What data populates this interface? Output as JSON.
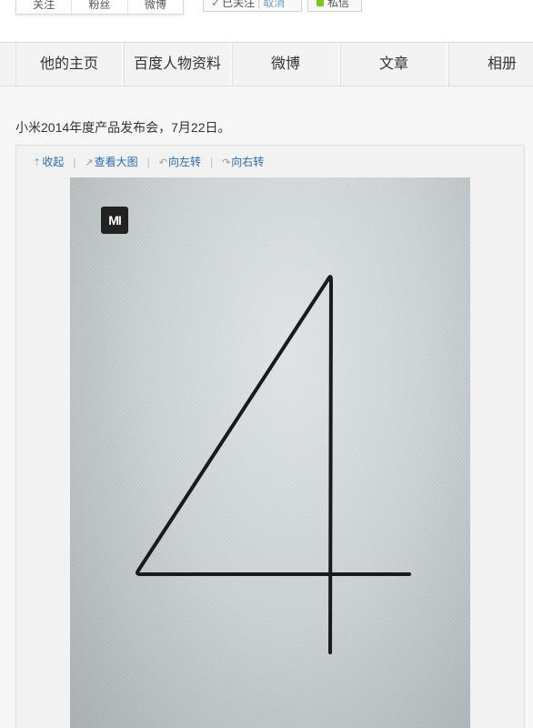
{
  "profile_bar": {
    "stats": [
      "关注",
      "粉丝",
      "微博"
    ],
    "follow_state": "已关注",
    "follow_cancel": "取消",
    "message": "私信"
  },
  "nav": {
    "tabs": [
      "他的主页",
      "百度人物资料",
      "微博",
      "文章",
      "相册"
    ]
  },
  "post": {
    "caption": "小米2014年度产品发布会，7月22日。",
    "toolbar": {
      "collapse": "收起",
      "view_large": "查看大图",
      "rotate_left": "向左转",
      "rotate_right": "向右转"
    },
    "image": {
      "logo_text": "MI",
      "digit": "4"
    }
  },
  "colors": {
    "link": "#2a6bb0",
    "message_dot": "#7bc91f",
    "logo_bg": "#222222"
  }
}
